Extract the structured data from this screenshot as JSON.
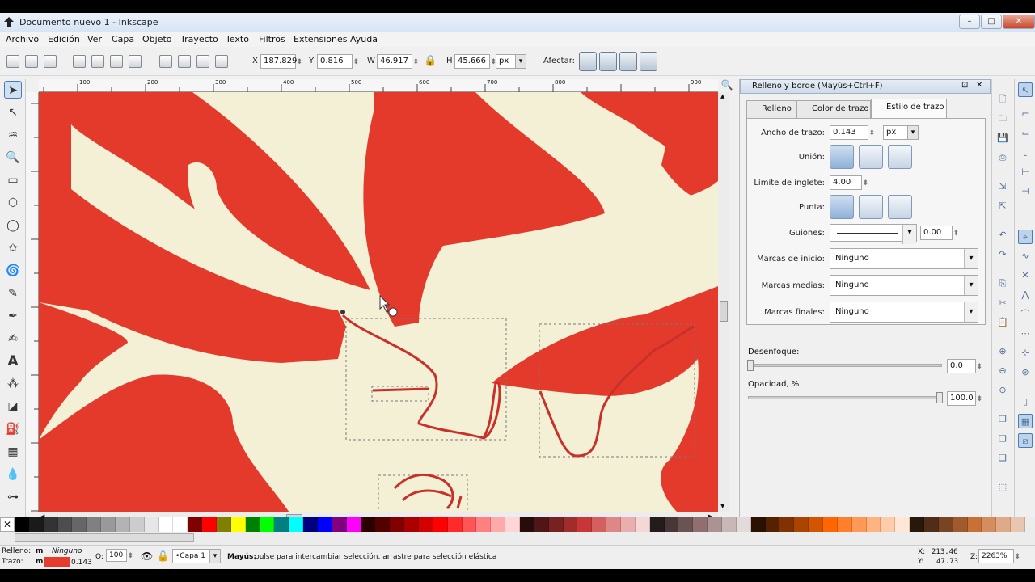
{
  "window": {
    "title": "Documento nuevo 1 - Inkscape",
    "minimize": "–",
    "maximize": "□",
    "close": "✕"
  },
  "menu": [
    "Archivo",
    "Edición",
    "Ver",
    "Capa",
    "Objeto",
    "Trayecto",
    "Texto",
    "Filtros",
    "Extensiones",
    "Ayuda"
  ],
  "toolbar": {
    "x_label": "X",
    "x_value": "187.829",
    "y_label": "Y",
    "y_value": "0.816",
    "w_label": "W",
    "w_value": "46.917",
    "h_label": "H",
    "h_value": "45.666",
    "unit": "px",
    "affect_label": "Afectar:"
  },
  "rulers": {
    "h_ticks": [
      "100",
      "200",
      "300",
      "400",
      "500",
      "600",
      "700",
      "800",
      "900"
    ],
    "v_ticks": [
      "900",
      "800",
      "700",
      "600",
      "500"
    ]
  },
  "dialog": {
    "title": "Relleno y borde (Mayús+Ctrl+F)",
    "tabs": [
      "Relleno",
      "Color de trazo",
      "Estilo de trazo"
    ],
    "stroke_width_label": "Ancho de trazo:",
    "stroke_width_value": "0.143",
    "stroke_unit": "px",
    "join_label": "Unión:",
    "miter_label": "Límite de inglete:",
    "miter_value": "4.00",
    "cap_label": "Punta:",
    "dashes_label": "Guiones:",
    "dashes_offset": "0.00",
    "start_markers_label": "Marcas de inicio:",
    "start_markers_value": "Ninguno",
    "mid_markers_label": "Marcas medias:",
    "mid_markers_value": "Ninguno",
    "end_markers_label": "Marcas finales:",
    "end_markers_value": "Ninguno",
    "blur_label": "Desenfoque:",
    "blur_value": "0.0",
    "opacity_label": "Opacidad, %",
    "opacity_value": "100.0"
  },
  "palette_colors": [
    "#000000",
    "#1a1a1a",
    "#333333",
    "#4d4d4d",
    "#666666",
    "#808080",
    "#999999",
    "#b3b3b3",
    "#cccccc",
    "#e6e6e6",
    "#ffffff",
    "#ffffff",
    "#800000",
    "#ff0000",
    "#808000",
    "#ffff00",
    "#008000",
    "#00ff00",
    "#008080",
    "#00ffff",
    "#000080",
    "#0000ff",
    "#800080",
    "#ff00ff",
    "#2b0000",
    "#550000",
    "#800000",
    "#aa0000",
    "#d40000",
    "#ff0000",
    "#ff2a2a",
    "#ff5555",
    "#ff8080",
    "#ffaaaa",
    "#ffd5d5",
    "#280b0b",
    "#501616",
    "#782121",
    "#a02c2c",
    "#c83737",
    "#d35f5f",
    "#de8787",
    "#e9afaf",
    "#f4d7d7",
    "#241c1c",
    "#483737",
    "#6c5353",
    "#916f6f",
    "#ac9393",
    "#c8b7b7",
    "#e3dbdb",
    "#2b1100",
    "#552200",
    "#803300",
    "#aa4400",
    "#d45500",
    "#ff6600",
    "#ff7f2a",
    "#ff9955",
    "#ffb380",
    "#ffccaa",
    "#ffe6d5",
    "#28170b",
    "#502d16",
    "#784421",
    "#a05a2c",
    "#c87137",
    "#d38d5f",
    "#deaa87",
    "#e9c6af"
  ],
  "status": {
    "fill_label": "Relleno:",
    "fill_m": "m",
    "fill_value": "Ninguno",
    "stroke_label": "Trazo:",
    "stroke_m": "m",
    "stroke_value": "0.143",
    "stroke_color": "#e53c2e",
    "opacity_label": "O:",
    "opacity_value": "100",
    "layer": "•Capa 1",
    "message_bold": "Mayús:",
    "message": " pulse para intercambiar selección, arrastre para selección elástica",
    "x_label": "X:",
    "x_value": "213.46",
    "y_label": "Y:",
    "y_value": "47.73",
    "zoom_label": "Z:",
    "zoom_value": "2263%"
  },
  "colors": {
    "canvas_bg": "#f3f0d6",
    "shape_red": "#e33a2c",
    "path_stroke": "#c8302a"
  }
}
